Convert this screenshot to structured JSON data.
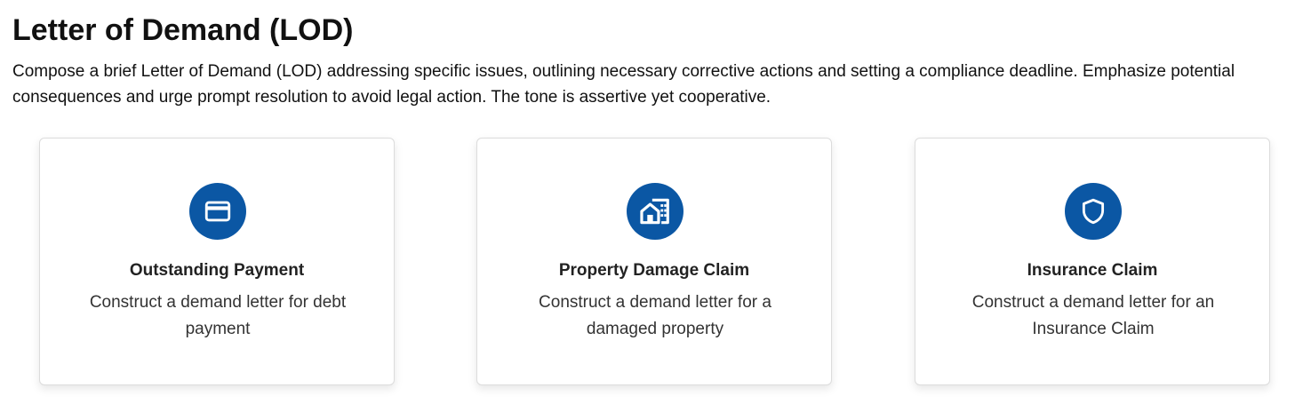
{
  "header": {
    "title": "Letter of Demand (LOD)",
    "description": "Compose a brief Letter of Demand (LOD) addressing specific issues, outlining necessary corrective actions and setting a compliance deadline. Emphasize potential consequences and urge prompt resolution to avoid legal action. The tone is assertive yet cooperative."
  },
  "theme": {
    "accent_color": "#0b57a4"
  },
  "cards": [
    {
      "icon": "credit-card-icon",
      "title": "Outstanding Payment",
      "description": "Construct a demand letter for debt payment"
    },
    {
      "icon": "building-house-icon",
      "title": "Property Damage Claim",
      "description": "Construct a demand letter for a damaged property"
    },
    {
      "icon": "shield-icon",
      "title": "Insurance Claim",
      "description": "Construct a demand letter for an Insurance Claim"
    }
  ]
}
